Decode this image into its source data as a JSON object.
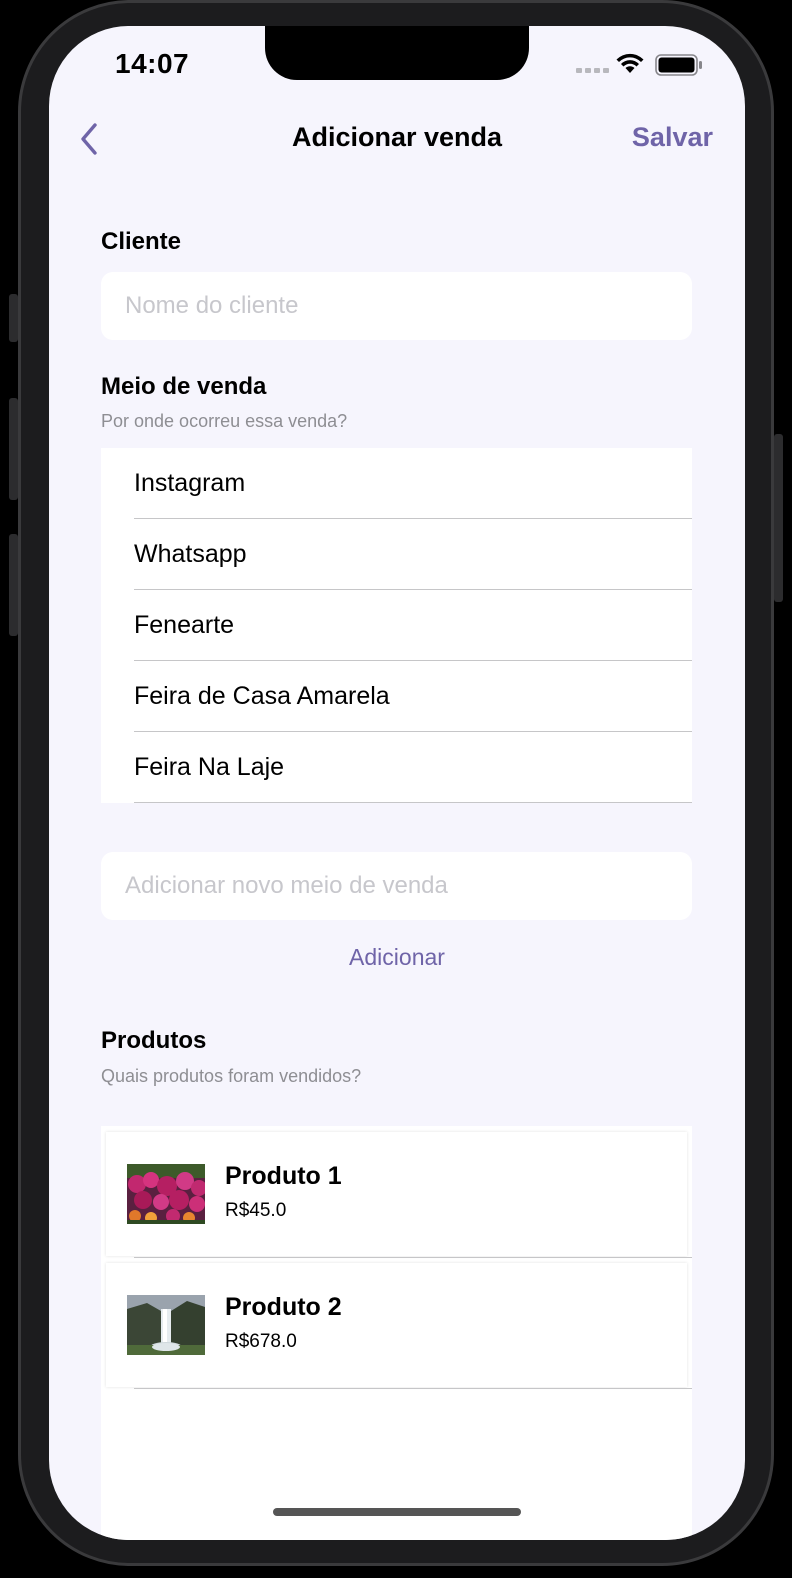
{
  "status_bar": {
    "time": "14:07"
  },
  "nav": {
    "title": "Adicionar venda",
    "save_label": "Salvar"
  },
  "cliente": {
    "label": "Cliente",
    "placeholder": "Nome do cliente"
  },
  "meio_de_venda": {
    "label": "Meio de venda",
    "subtitle": "Por onde ocorreu essa venda?",
    "items": [
      "Instagram",
      "Whatsapp",
      "Fenearte",
      "Feira de Casa Amarela",
      "Feira Na Laje"
    ],
    "new_placeholder": "Adicionar novo meio de venda",
    "add_label": "Adicionar"
  },
  "produtos": {
    "label": "Produtos",
    "subtitle": "Quais produtos foram vendidos?",
    "items": [
      {
        "name": "Produto 1",
        "price": "R$45.0",
        "image": "flowers-photo"
      },
      {
        "name": "Produto 2",
        "price": "R$678.0",
        "image": "waterfall-photo"
      }
    ]
  },
  "colors": {
    "accent": "#6f64a8",
    "background": "#f6f5fd"
  }
}
